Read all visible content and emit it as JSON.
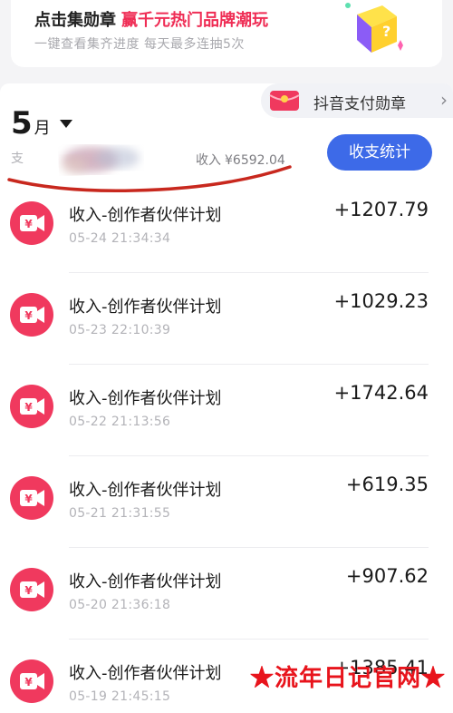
{
  "promo": {
    "title": "点击集勋章",
    "highlight": "赢千元热门品牌潮玩",
    "subtitle": "一键查看集齐进度 每天最多连抽5次"
  },
  "header": {
    "pay_badge_label": "抖音支付勋章",
    "pay_badge_arrow": "›",
    "month_number": "5",
    "month_unit": "月",
    "expense_label": "支",
    "income_label": "收入",
    "income_value": "¥6592.04",
    "stats_button": "收支统计"
  },
  "colors": {
    "accent_blue": "#3d6ae8",
    "icon_red": "#f0395e",
    "highlight_pink": "#ef2d55",
    "watermark_red": "#e8141c"
  },
  "transactions": [
    {
      "icon": "video-camera-yuan-icon",
      "title": "收入-创作者伙伴计划",
      "time": "05-24 21:34:34",
      "amount": "+1207.79"
    },
    {
      "icon": "video-camera-yuan-icon",
      "title": "收入-创作者伙伴计划",
      "time": "05-23 22:10:39",
      "amount": "+1029.23"
    },
    {
      "icon": "video-camera-yuan-icon",
      "title": "收入-创作者伙伴计划",
      "time": "05-22 21:13:56",
      "amount": "+1742.64"
    },
    {
      "icon": "video-camera-yuan-icon",
      "title": "收入-创作者伙伴计划",
      "time": "05-21 21:31:55",
      "amount": "+619.35"
    },
    {
      "icon": "video-camera-yuan-icon",
      "title": "收入-创作者伙伴计划",
      "time": "05-20 21:36:18",
      "amount": "+907.62"
    },
    {
      "icon": "video-camera-yuan-icon",
      "title": "收入-创作者伙伴计划",
      "time": "05-19 21:45:15",
      "amount": "+1385.41"
    }
  ],
  "watermark": "★流年日记官网★"
}
